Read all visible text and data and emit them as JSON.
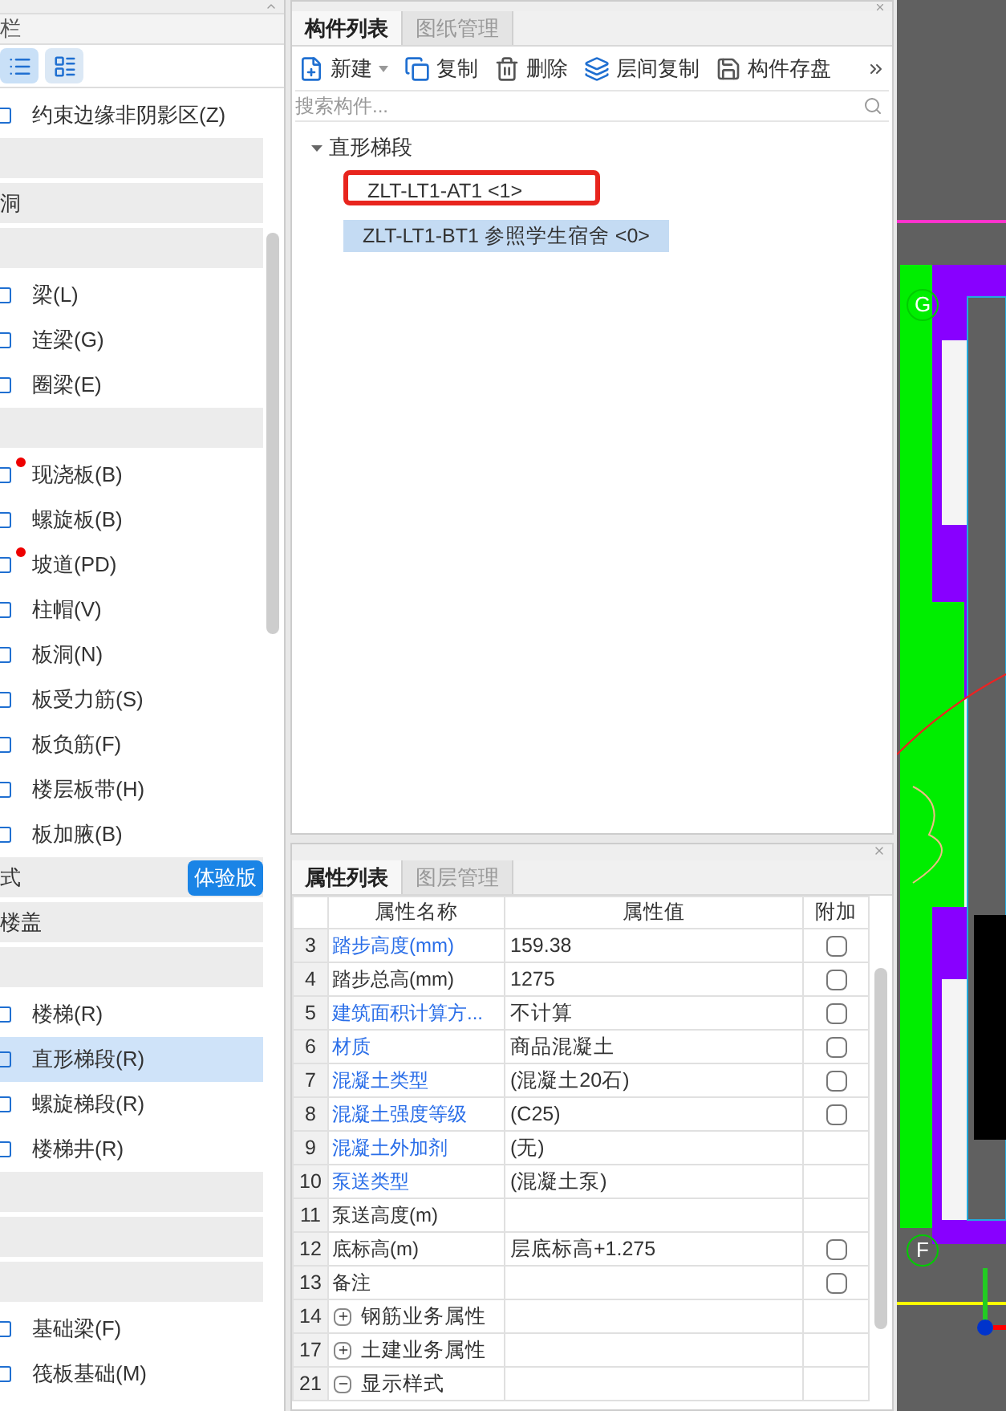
{
  "sidebar": {
    "title": "栏",
    "view_buttons": [
      {
        "selected": true
      },
      {
        "selected": false
      }
    ],
    "items": [
      {
        "kind": "item",
        "label": "约束边缘非阴影区(Z)",
        "selected": false,
        "marked": false
      },
      {
        "kind": "group"
      },
      {
        "kind": "group",
        "label": "洞"
      },
      {
        "kind": "group"
      },
      {
        "kind": "item",
        "label": "梁(L)",
        "selected": false,
        "marked": false
      },
      {
        "kind": "item",
        "label": "连梁(G)",
        "selected": false,
        "marked": false
      },
      {
        "kind": "item",
        "label": "圈梁(E)",
        "selected": false,
        "marked": false
      },
      {
        "kind": "group"
      },
      {
        "kind": "item",
        "label": "现浇板(B)",
        "selected": false,
        "marked": true
      },
      {
        "kind": "item",
        "label": "螺旋板(B)",
        "selected": false,
        "marked": false
      },
      {
        "kind": "item",
        "label": "坡道(PD)",
        "selected": false,
        "marked": true
      },
      {
        "kind": "item",
        "label": "柱帽(V)",
        "selected": false,
        "marked": false
      },
      {
        "kind": "item",
        "label": "板洞(N)",
        "selected": false,
        "marked": false
      },
      {
        "kind": "item",
        "label": "板受力筋(S)",
        "selected": false,
        "marked": false
      },
      {
        "kind": "item",
        "label": "板负筋(F)",
        "selected": false,
        "marked": false
      },
      {
        "kind": "item",
        "label": "楼层板带(H)",
        "selected": false,
        "marked": false
      },
      {
        "kind": "item",
        "label": "板加腋(B)",
        "selected": false,
        "marked": false
      },
      {
        "kind": "group",
        "label": "式",
        "badge": "体验版"
      },
      {
        "kind": "group",
        "label": "楼盖"
      },
      {
        "kind": "group"
      },
      {
        "kind": "item",
        "label": "楼梯(R)",
        "selected": false,
        "marked": false
      },
      {
        "kind": "item",
        "label": "直形梯段(R)",
        "selected": true,
        "marked": false
      },
      {
        "kind": "item",
        "label": "螺旋梯段(R)",
        "selected": false,
        "marked": false
      },
      {
        "kind": "item",
        "label": "楼梯井(R)",
        "selected": false,
        "marked": false
      },
      {
        "kind": "group"
      },
      {
        "kind": "group"
      },
      {
        "kind": "group"
      },
      {
        "kind": "item",
        "label": "基础梁(F)",
        "selected": false,
        "marked": false
      },
      {
        "kind": "item",
        "label": "筏板基础(M)",
        "selected": false,
        "marked": false
      }
    ]
  },
  "component_panel": {
    "tabs": [
      {
        "label": "构件列表",
        "selected": true
      },
      {
        "label": "图纸管理",
        "selected": false
      }
    ],
    "toolbar": [
      {
        "kind": "new",
        "label": "新建",
        "dropdown": true
      },
      {
        "kind": "copy",
        "label": "复制",
        "dropdown": false
      },
      {
        "kind": "delete",
        "label": "删除",
        "dropdown": false
      },
      {
        "kind": "floor-copy",
        "label": "层间复制",
        "dropdown": false
      },
      {
        "kind": "save",
        "label": "构件存盘",
        "dropdown": false
      }
    ],
    "search": {
      "placeholder": "搜索构件..."
    },
    "tree": [
      {
        "label": "直形梯段",
        "expanded": true,
        "children": [
          {
            "label": "ZLT-LT1-AT1 <1>",
            "selected": false,
            "highlighted": true
          },
          {
            "label": "ZLT-LT1-BT1 参照学生宿舍 <0>",
            "selected": true,
            "highlighted": false
          }
        ]
      }
    ]
  },
  "property_panel": {
    "tabs": [
      {
        "label": "属性列表",
        "selected": true
      },
      {
        "label": "图层管理",
        "selected": false
      }
    ],
    "columns": [
      "属性名称",
      "属性值",
      "附加"
    ],
    "rows": [
      {
        "kind": "prop",
        "num": "3",
        "name": "踏步高度(mm)",
        "linked": true,
        "value": "159.38",
        "checked": false
      },
      {
        "kind": "prop",
        "num": "4",
        "name": "踏步总高(mm)",
        "linked": false,
        "value": "1275",
        "checked": false
      },
      {
        "kind": "prop",
        "num": "5",
        "name": "建筑面积计算方...",
        "linked": true,
        "value": "不计算",
        "checked": false
      },
      {
        "kind": "prop",
        "num": "6",
        "name": "材质",
        "linked": true,
        "value": "商品混凝土",
        "checked": false
      },
      {
        "kind": "prop",
        "num": "7",
        "name": "混凝土类型",
        "linked": true,
        "value": "(混凝土20石)",
        "checked": false
      },
      {
        "kind": "prop",
        "num": "8",
        "name": "混凝土强度等级",
        "linked": true,
        "value": "(C25)",
        "checked": false
      },
      {
        "kind": "prop",
        "num": "9",
        "name": "混凝土外加剂",
        "linked": true,
        "value": "(无)"
      },
      {
        "kind": "prop",
        "num": "10",
        "name": "泵送类型",
        "linked": true,
        "value": "(混凝土泵)"
      },
      {
        "kind": "prop",
        "num": "11",
        "name": "泵送高度(m)",
        "linked": false
      },
      {
        "kind": "prop",
        "num": "12",
        "name": "底标高(m)",
        "linked": false,
        "value": "层底标高+1.275",
        "checked": false
      },
      {
        "kind": "prop",
        "num": "13",
        "name": "备注",
        "linked": false,
        "checked": false
      },
      {
        "kind": "group",
        "num": "14",
        "name": "钢筋业务属性",
        "expanded": false
      },
      {
        "kind": "group",
        "num": "17",
        "name": "土建业务属性",
        "expanded": false
      },
      {
        "kind": "group",
        "num": "21",
        "name": "显示样式",
        "expanded": true
      }
    ]
  },
  "canvas": {
    "axis_labels": [
      "G",
      "F"
    ]
  }
}
